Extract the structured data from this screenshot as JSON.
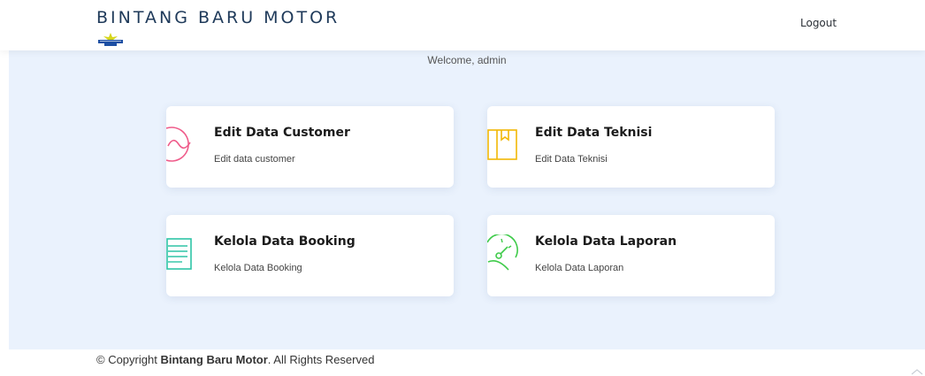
{
  "header": {
    "brand": "BINTANG BARU MOTOR",
    "logo_text": "BINTANG BARU MOTOR",
    "logout_label": "Logout"
  },
  "main": {
    "welcome": "Welcome, admin",
    "cards": [
      {
        "title": "Edit Data Customer",
        "description": "Edit data customer",
        "icon": "wave-circle-icon",
        "color": "#ef5b8a"
      },
      {
        "title": "Edit Data Teknisi",
        "description": "Edit Data Teknisi",
        "icon": "book-icon",
        "color": "#f2b705"
      },
      {
        "title": "Kelola Data Booking",
        "description": "Kelola Data Booking",
        "icon": "document-lines-icon",
        "color": "#2ec4a6"
      },
      {
        "title": "Kelola Data Laporan",
        "description": "Kelola Data Laporan",
        "icon": "speedometer-icon",
        "color": "#3fcb4a"
      }
    ]
  },
  "footer": {
    "prefix": "© Copyright ",
    "company": "Bintang Baru Motor",
    "suffix": ". All Rights Reserved"
  },
  "colors": {
    "main_background": "#eaf2fd",
    "brand_text": "#1f3a5a"
  }
}
